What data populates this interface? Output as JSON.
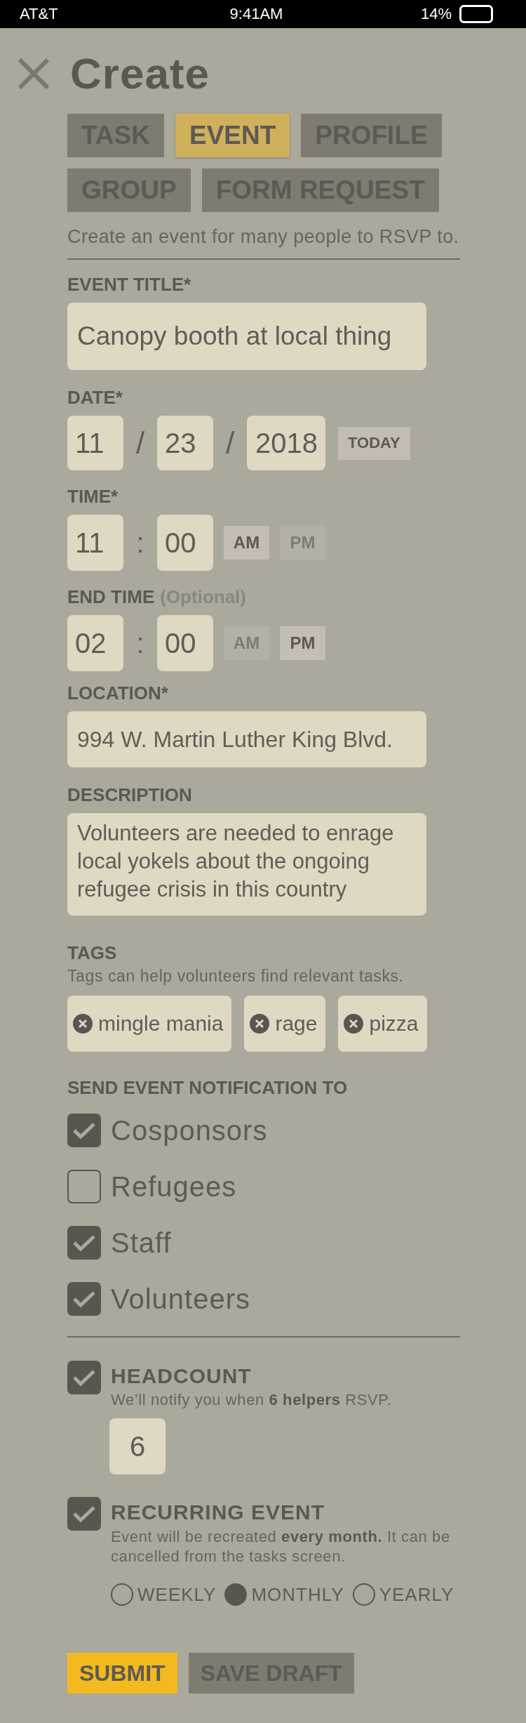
{
  "status_bar": {
    "carrier": "AT&T",
    "time": "9:41AM",
    "battery": "14%"
  },
  "title": "Create",
  "tabs": [
    {
      "label": "TASK",
      "selected": false
    },
    {
      "label": "EVENT",
      "selected": true
    },
    {
      "label": "PROFILE",
      "selected": false
    },
    {
      "label": "GROUP",
      "selected": false
    },
    {
      "label": "FORM REQUEST",
      "selected": false
    }
  ],
  "intro": "Create an event for many people to RSVP to.",
  "event_title": {
    "label": "EVENT TITLE*",
    "value": "Canopy booth at local thing"
  },
  "date": {
    "label": "DATE*",
    "month": "11",
    "separator_1": "/",
    "day": "23",
    "separator_2": "/",
    "year": "2018",
    "today_button": "TODAY"
  },
  "time": {
    "label": "TIME*",
    "hour": "11",
    "separator": ":",
    "minute": "00",
    "meridiem": [
      {
        "label": "AM",
        "selected": true
      },
      {
        "label": "PM",
        "selected": false
      }
    ]
  },
  "end_time": {
    "label": "END TIME",
    "label_note": "(Optional)",
    "hour": "02",
    "separator": ":",
    "minute": "00",
    "meridiem": [
      {
        "label": "AM",
        "selected": false
      },
      {
        "label": "PM",
        "selected": true
      }
    ]
  },
  "location": {
    "label": "LOCATION*",
    "value": "994 W. Martin Luther King Blvd."
  },
  "description": {
    "label": "DESCRIPTION",
    "value": "Volunteers are needed to enrage local yokels about the ongoing refugee crisis in this country"
  },
  "tags": {
    "label": "TAGS",
    "hint": "Tags can help volunteers find relevant tasks.",
    "items": [
      "mingle mania",
      "rage",
      "pizza"
    ]
  },
  "notify": {
    "label": "SEND EVENT NOTIFICATION TO",
    "options": [
      {
        "label": "Cosponsors",
        "checked": true
      },
      {
        "label": "Refugees",
        "checked": false
      },
      {
        "label": "Staff",
        "checked": true
      },
      {
        "label": "Volunteers",
        "checked": true
      }
    ]
  },
  "headcount": {
    "checked": true,
    "label": "HEADCOUNT",
    "hint": "We’ll notify you when **6 helpers** RSVP.",
    "value": "6"
  },
  "recurring": {
    "checked": true,
    "label": "RECURRING EVENT",
    "hint": "Event will be recreated **every month.** It can be cancelled from the tasks screen.",
    "frequencies": [
      {
        "label": "WEEKLY",
        "selected": false
      },
      {
        "label": "MONTHLY",
        "selected": true
      },
      {
        "label": "YEARLY",
        "selected": false
      }
    ]
  },
  "buttons": [
    {
      "label": "SUBMIT",
      "kind": "primary"
    },
    {
      "label": "SAVE DRAFT",
      "kind": "secondary"
    }
  ]
}
